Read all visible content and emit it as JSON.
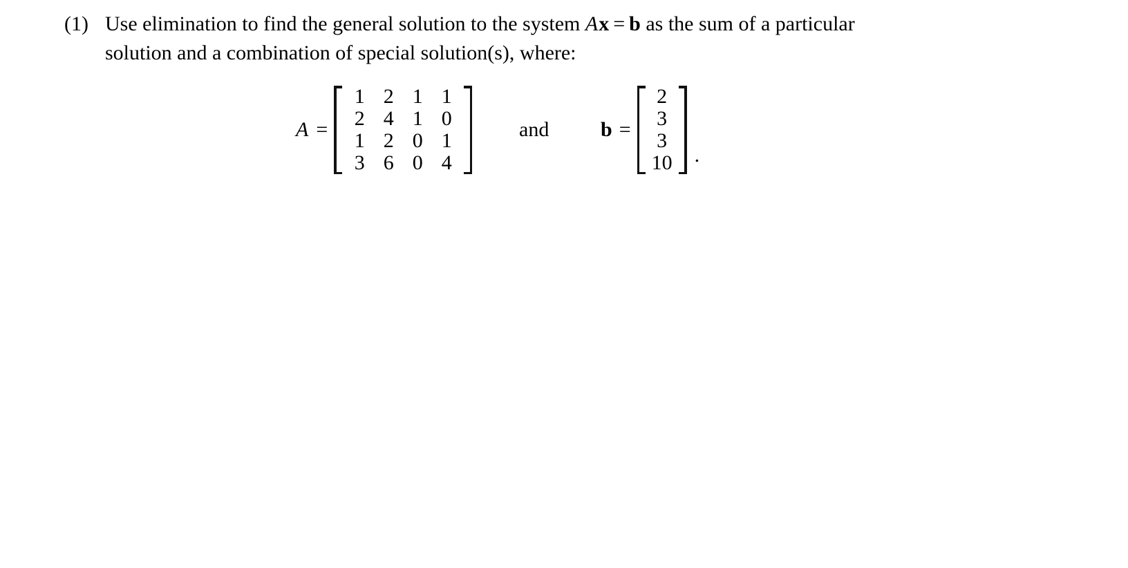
{
  "document": {
    "background_color": "#ffffff",
    "text_color": "#000000"
  },
  "problem": {
    "number_label": "(1)",
    "line1_part1": "Use elimination to find the general solution to the system ",
    "matrix_symbol_A_inline": "A",
    "vector_symbol_x_inline": "x",
    "equals_inline": "=",
    "vector_symbol_b_inline": "b",
    "line1_part2": " as the sum of a particular",
    "line2": "solution and a combination of special solution(s), where:"
  },
  "display_math": {
    "A_label": "A",
    "A_equals": "=",
    "conjunction": "and",
    "b_label": "b",
    "b_equals": "=",
    "trailing_punctuation": ".",
    "matrix_A": {
      "name": "A",
      "rows": 4,
      "cols": 4,
      "values": [
        [
          "1",
          "2",
          "1",
          "1"
        ],
        [
          "2",
          "4",
          "1",
          "0"
        ],
        [
          "1",
          "2",
          "0",
          "1"
        ],
        [
          "3",
          "6",
          "0",
          "4"
        ]
      ]
    },
    "vector_b": {
      "name": "b",
      "rows": 4,
      "cols": 1,
      "values": [
        [
          "2"
        ],
        [
          "3"
        ],
        [
          "3"
        ],
        [
          "10"
        ]
      ]
    }
  }
}
